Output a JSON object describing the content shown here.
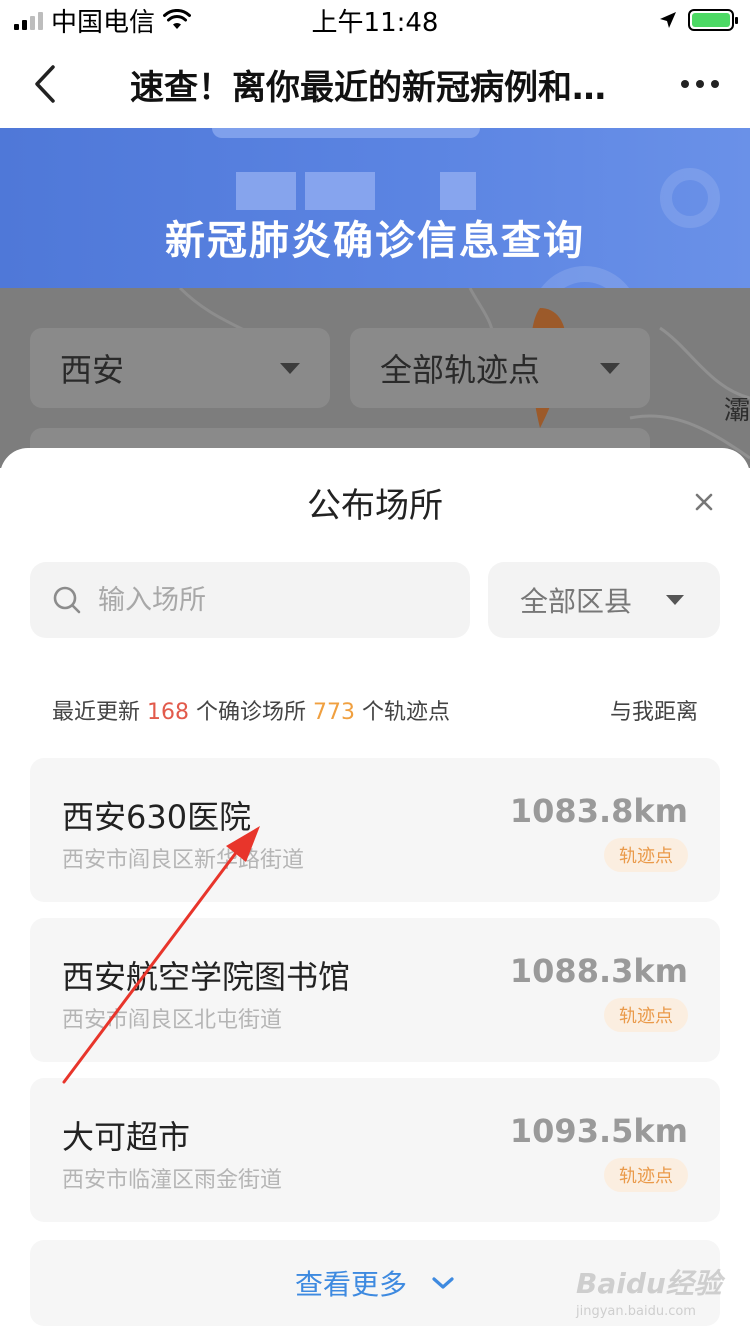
{
  "status_bar": {
    "carrier": "中国电信",
    "time": "上午11:48"
  },
  "nav": {
    "title": "速查！离你最近的新冠病例和…"
  },
  "banner": {
    "title": "新冠肺炎确诊信息查询"
  },
  "map_filters": {
    "city": "西安",
    "points_filter": "全部轨迹点",
    "map_label": "灞"
  },
  "sheet": {
    "title": "公布场所",
    "search_placeholder": "输入场所",
    "district_select": "全部区县",
    "summary": {
      "prefix": "最近更新",
      "places_count": "168",
      "places_label": "个确诊场所",
      "points_count": "773",
      "points_label": "个轨迹点",
      "sort_label": "与我距离"
    },
    "places": [
      {
        "name": "西安630医院",
        "address": "西安市阎良区新华路街道",
        "distance": "1083.8km",
        "tag": "轨迹点"
      },
      {
        "name": "西安航空学院图书馆",
        "address": "西安市阎良区北屯街道",
        "distance": "1088.3km",
        "tag": "轨迹点"
      },
      {
        "name": "大可超市",
        "address": "西安市临潼区雨金街道",
        "distance": "1093.5km",
        "tag": "轨迹点"
      }
    ],
    "more_label": "查看更多"
  },
  "watermark": {
    "main": "Baidu经验",
    "sub": "jingyan.baidu.com"
  },
  "colors": {
    "banner_blue": "#5b84e2",
    "accent_red": "#e25a4b",
    "accent_orange": "#f0a040",
    "link_blue": "#3e8ae0",
    "annotation_arrow": "#e8352b"
  }
}
